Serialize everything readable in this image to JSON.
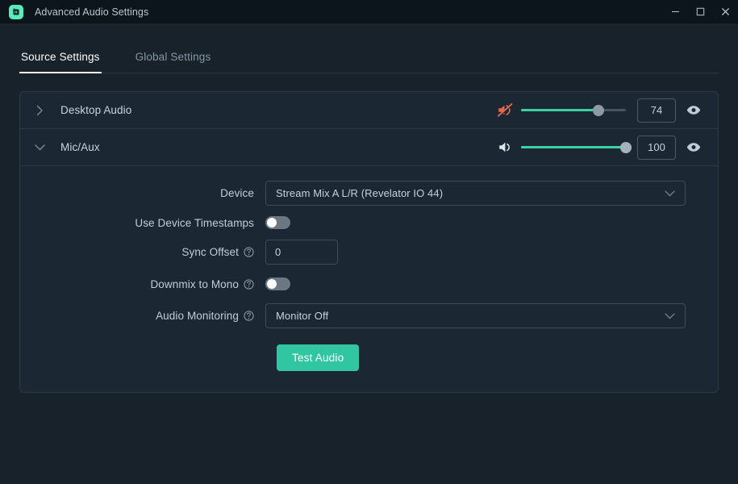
{
  "window": {
    "title": "Advanced Audio Settings",
    "app_icon": "streamlabs-icon",
    "accent_color": "#31c6a2",
    "muted_color": "#e8674f",
    "controls": {
      "minimize": "minimize-icon",
      "maximize": "maximize-icon",
      "close": "close-icon"
    }
  },
  "tabs": [
    {
      "label": "Source Settings",
      "active": true
    },
    {
      "label": "Global Settings",
      "active": false
    }
  ],
  "sources": [
    {
      "name": "Desktop Audio",
      "expanded": false,
      "chevron": "chevron-right-icon",
      "muted": true,
      "mute_icon": "speaker-muted-icon",
      "volume": 74,
      "volume_text": "74",
      "visibility_icon": "eye-icon"
    },
    {
      "name": "Mic/Aux",
      "expanded": true,
      "chevron": "chevron-down-icon",
      "muted": false,
      "mute_icon": "speaker-on-icon",
      "volume": 100,
      "volume_text": "100",
      "visibility_icon": "eye-icon"
    }
  ],
  "source_settings": {
    "device": {
      "label": "Device",
      "value": "Stream Mix A L/R (Revelator IO 44)",
      "caret": "chevron-down-icon"
    },
    "use_device_timestamps": {
      "label": "Use Device Timestamps",
      "value": "off"
    },
    "sync_offset": {
      "label": "Sync Offset",
      "help_icon": "question-mark-icon",
      "value": "0",
      "placeholder": "0"
    },
    "downmix_to_mono": {
      "label": "Downmix to Mono",
      "help_icon": "question-mark-icon",
      "value": "off"
    },
    "audio_monitoring": {
      "label": "Audio Monitoring",
      "help_icon": "question-mark-icon",
      "value": "Monitor Off",
      "caret": "chevron-down-icon"
    },
    "test_audio_button": "Test Audio"
  }
}
